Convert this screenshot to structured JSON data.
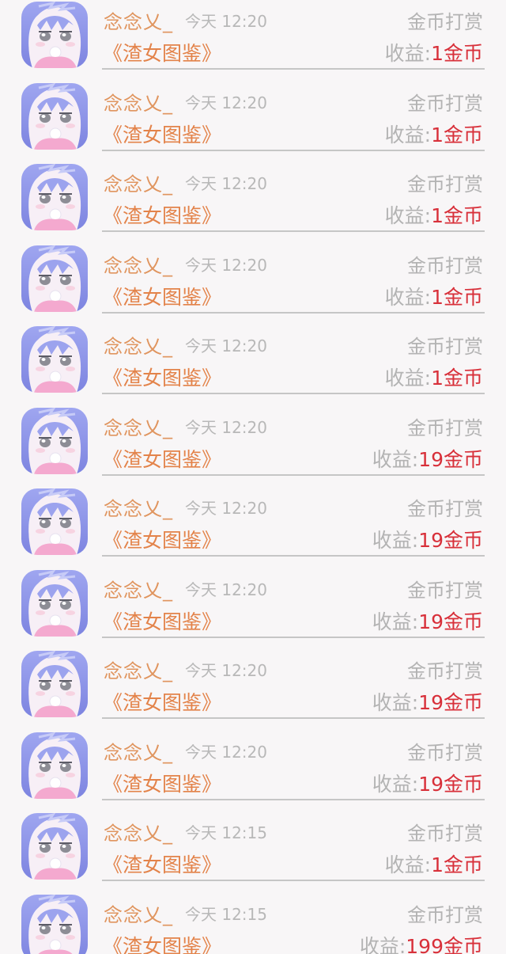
{
  "records": [
    {
      "user": "念念乂_",
      "time": "今天 12:20",
      "type": "金币打赏",
      "book": "《渣女图鉴》",
      "income_label": "收益:",
      "income_amount": "1金币"
    },
    {
      "user": "念念乂_",
      "time": "今天 12:20",
      "type": "金币打赏",
      "book": "《渣女图鉴》",
      "income_label": "收益:",
      "income_amount": "1金币"
    },
    {
      "user": "念念乂_",
      "time": "今天 12:20",
      "type": "金币打赏",
      "book": "《渣女图鉴》",
      "income_label": "收益:",
      "income_amount": "1金币"
    },
    {
      "user": "念念乂_",
      "time": "今天 12:20",
      "type": "金币打赏",
      "book": "《渣女图鉴》",
      "income_label": "收益:",
      "income_amount": "1金币"
    },
    {
      "user": "念念乂_",
      "time": "今天 12:20",
      "type": "金币打赏",
      "book": "《渣女图鉴》",
      "income_label": "收益:",
      "income_amount": "1金币"
    },
    {
      "user": "念念乂_",
      "time": "今天 12:20",
      "type": "金币打赏",
      "book": "《渣女图鉴》",
      "income_label": "收益:",
      "income_amount": "19金币"
    },
    {
      "user": "念念乂_",
      "time": "今天 12:20",
      "type": "金币打赏",
      "book": "《渣女图鉴》",
      "income_label": "收益:",
      "income_amount": "19金币"
    },
    {
      "user": "念念乂_",
      "time": "今天 12:20",
      "type": "金币打赏",
      "book": "《渣女图鉴》",
      "income_label": "收益:",
      "income_amount": "19金币"
    },
    {
      "user": "念念乂_",
      "time": "今天 12:20",
      "type": "金币打赏",
      "book": "《渣女图鉴》",
      "income_label": "收益:",
      "income_amount": "19金币"
    },
    {
      "user": "念念乂_",
      "time": "今天 12:20",
      "type": "金币打赏",
      "book": "《渣女图鉴》",
      "income_label": "收益:",
      "income_amount": "19金币"
    },
    {
      "user": "念念乂_",
      "time": "今天 12:15",
      "type": "金币打赏",
      "book": "《渣女图鉴》",
      "income_label": "收益:",
      "income_amount": "1金币"
    },
    {
      "user": "念念乂_",
      "time": "今天 12:15",
      "type": "金币打赏",
      "book": "《渣女图鉴》",
      "income_label": "收益:",
      "income_amount": "199金币"
    }
  ],
  "avatar_icon": "anime-girl-avatar-icon",
  "colors": {
    "background": "#f8f6f7",
    "user_name": "#e0955f",
    "book_title": "#e3834a",
    "muted_text": "#b3b3b3",
    "income_amount": "#d8303a",
    "divider": "#c6c6c6"
  }
}
